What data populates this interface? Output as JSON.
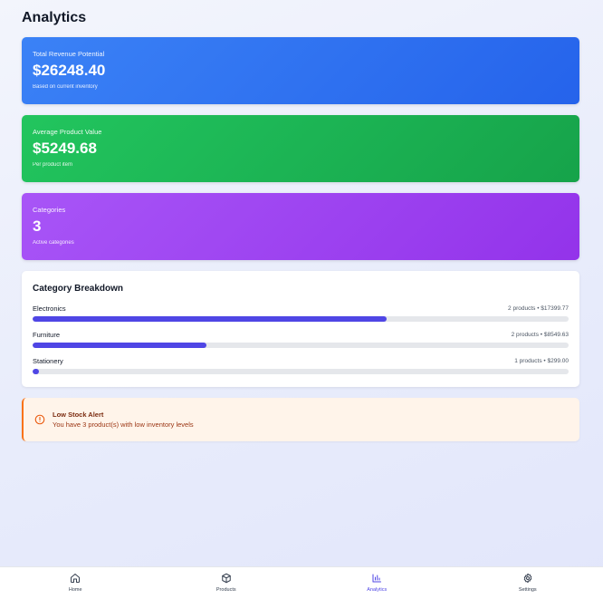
{
  "page": {
    "title": "Analytics"
  },
  "stats": [
    {
      "label": "Total Revenue Potential",
      "value": "$26248.40",
      "sub": "Based on current inventory"
    },
    {
      "label": "Average Product Value",
      "value": "$5249.68",
      "sub": "Per product item"
    },
    {
      "label": "Categories",
      "value": "3",
      "sub": "Active categories"
    }
  ],
  "breakdown": {
    "title": "Category Breakdown",
    "items": [
      {
        "name": "Electronics",
        "meta": "2 products • $17399.77",
        "share": 0.66
      },
      {
        "name": "Furniture",
        "meta": "2 products • $8549.63",
        "share": 0.325
      },
      {
        "name": "Stationery",
        "meta": "1 products • $299.00",
        "share": 0.012
      }
    ]
  },
  "alert": {
    "title": "Low Stock Alert",
    "text": "You have 3 product(s) with low inventory levels",
    "icon": "alert-circle-icon"
  },
  "nav": {
    "items": [
      {
        "label": "Home",
        "icon": "home-icon",
        "active": false
      },
      {
        "label": "Products",
        "icon": "box-icon",
        "active": false
      },
      {
        "label": "Analytics",
        "icon": "bar-chart-icon",
        "active": true
      },
      {
        "label": "Settings",
        "icon": "gear-icon",
        "active": false
      }
    ]
  },
  "colors": {
    "accent": "#4f46e5",
    "blue_card": "#2563eb",
    "green_card": "#16a34a",
    "purple_card": "#9333ea",
    "alert_orange": "#f97316"
  }
}
